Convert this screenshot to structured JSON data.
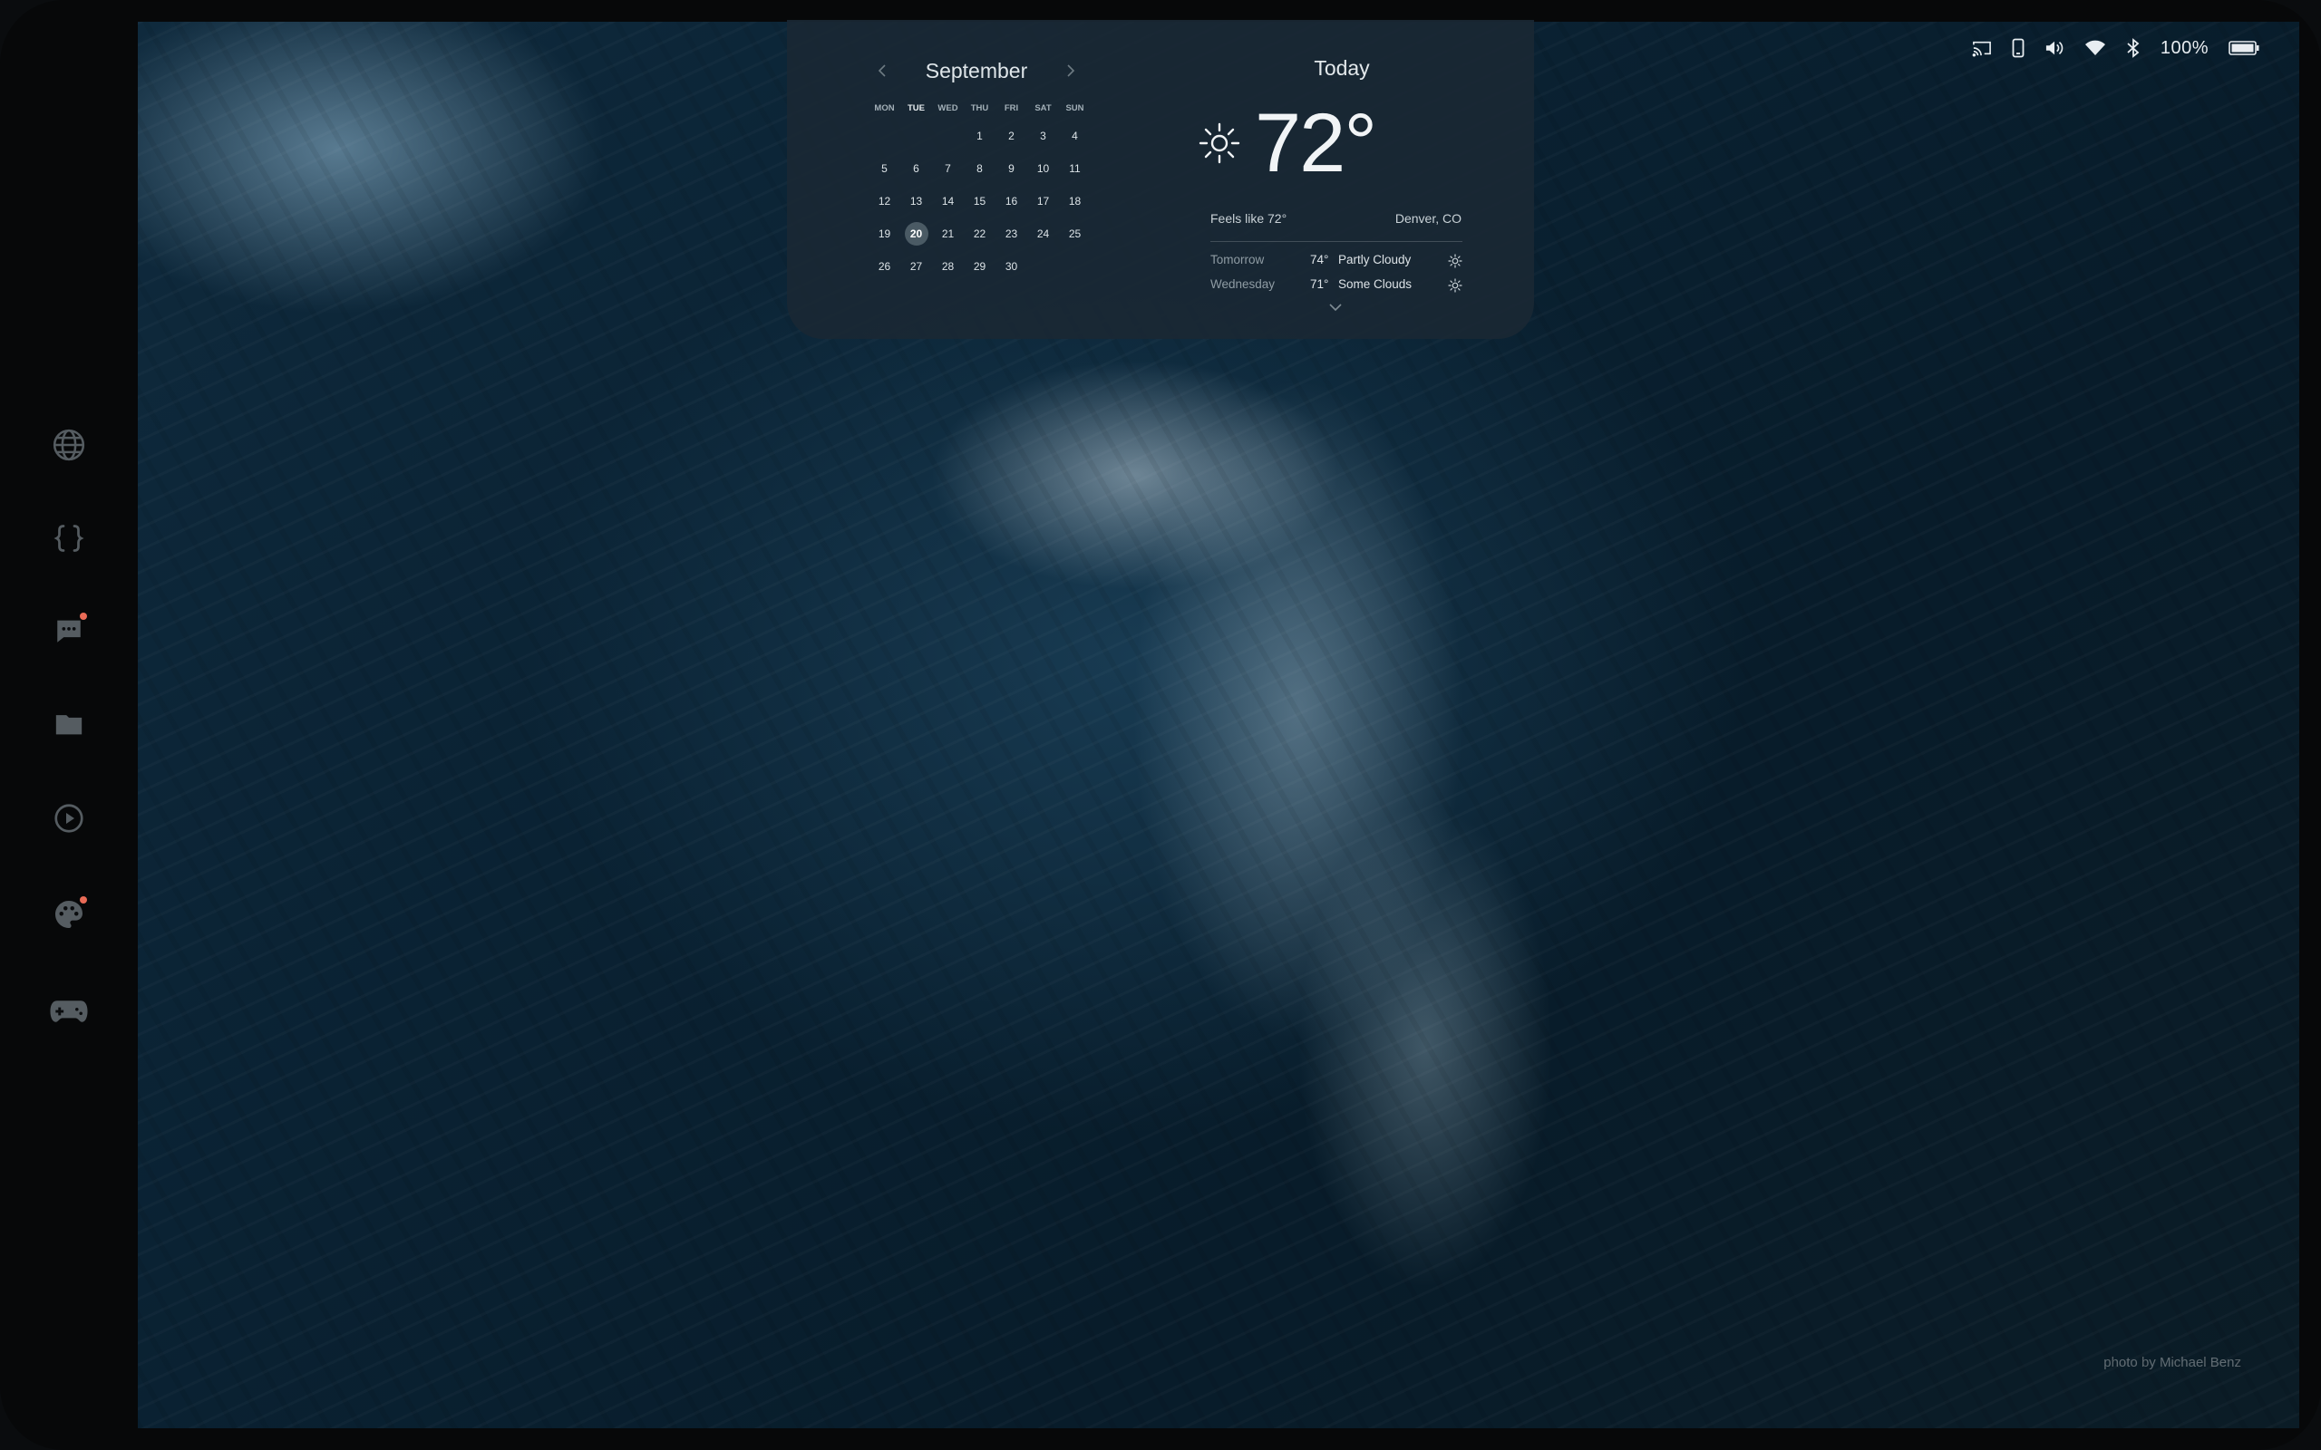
{
  "wallpaper": {
    "credit": "photo by Michael Benz"
  },
  "dock": {
    "items": [
      {
        "name": "globe-icon"
      },
      {
        "name": "code-braces-icon"
      },
      {
        "name": "chat-icon",
        "notification": true
      },
      {
        "name": "folder-icon"
      },
      {
        "name": "play-circle-icon"
      },
      {
        "name": "palette-icon",
        "notification": true
      },
      {
        "name": "gamepad-icon"
      }
    ]
  },
  "status_bar": {
    "icons": [
      "cast-icon",
      "phone-icon",
      "volume-icon",
      "wifi-icon",
      "bluetooth-icon",
      "battery-icon"
    ],
    "battery_percent": "100%"
  },
  "calendar": {
    "month": "September",
    "weekdays": [
      "MON",
      "TUE",
      "WED",
      "THU",
      "FRI",
      "SAT",
      "SUN"
    ],
    "current_weekday": "TUE",
    "today": "20",
    "weeks": [
      [
        "",
        "",
        "",
        "1",
        "2",
        "3",
        "4"
      ],
      [
        "5",
        "6",
        "7",
        "8",
        "9",
        "10",
        "11"
      ],
      [
        "12",
        "13",
        "14",
        "15",
        "16",
        "17",
        "18"
      ],
      [
        "19",
        "20",
        "21",
        "22",
        "23",
        "24",
        "25"
      ],
      [
        "26",
        "27",
        "28",
        "29",
        "30",
        "",
        ""
      ]
    ]
  },
  "weather": {
    "title": "Today",
    "temperature": "72°",
    "feels_like": "Feels like 72°",
    "location": "Denver, CO",
    "icon": "sun-icon",
    "forecast": [
      {
        "day": "Tomorrow",
        "temp": "74°",
        "condition": "Partly Cloudy",
        "icon": "sun-icon"
      },
      {
        "day": "Wednesday",
        "temp": "71°",
        "condition": "Some Clouds",
        "icon": "sun-icon"
      }
    ]
  },
  "colors": {
    "accent_dot": "#e96b57",
    "widget_bg": "#1a2834",
    "icon_gray": "#4c5358"
  }
}
